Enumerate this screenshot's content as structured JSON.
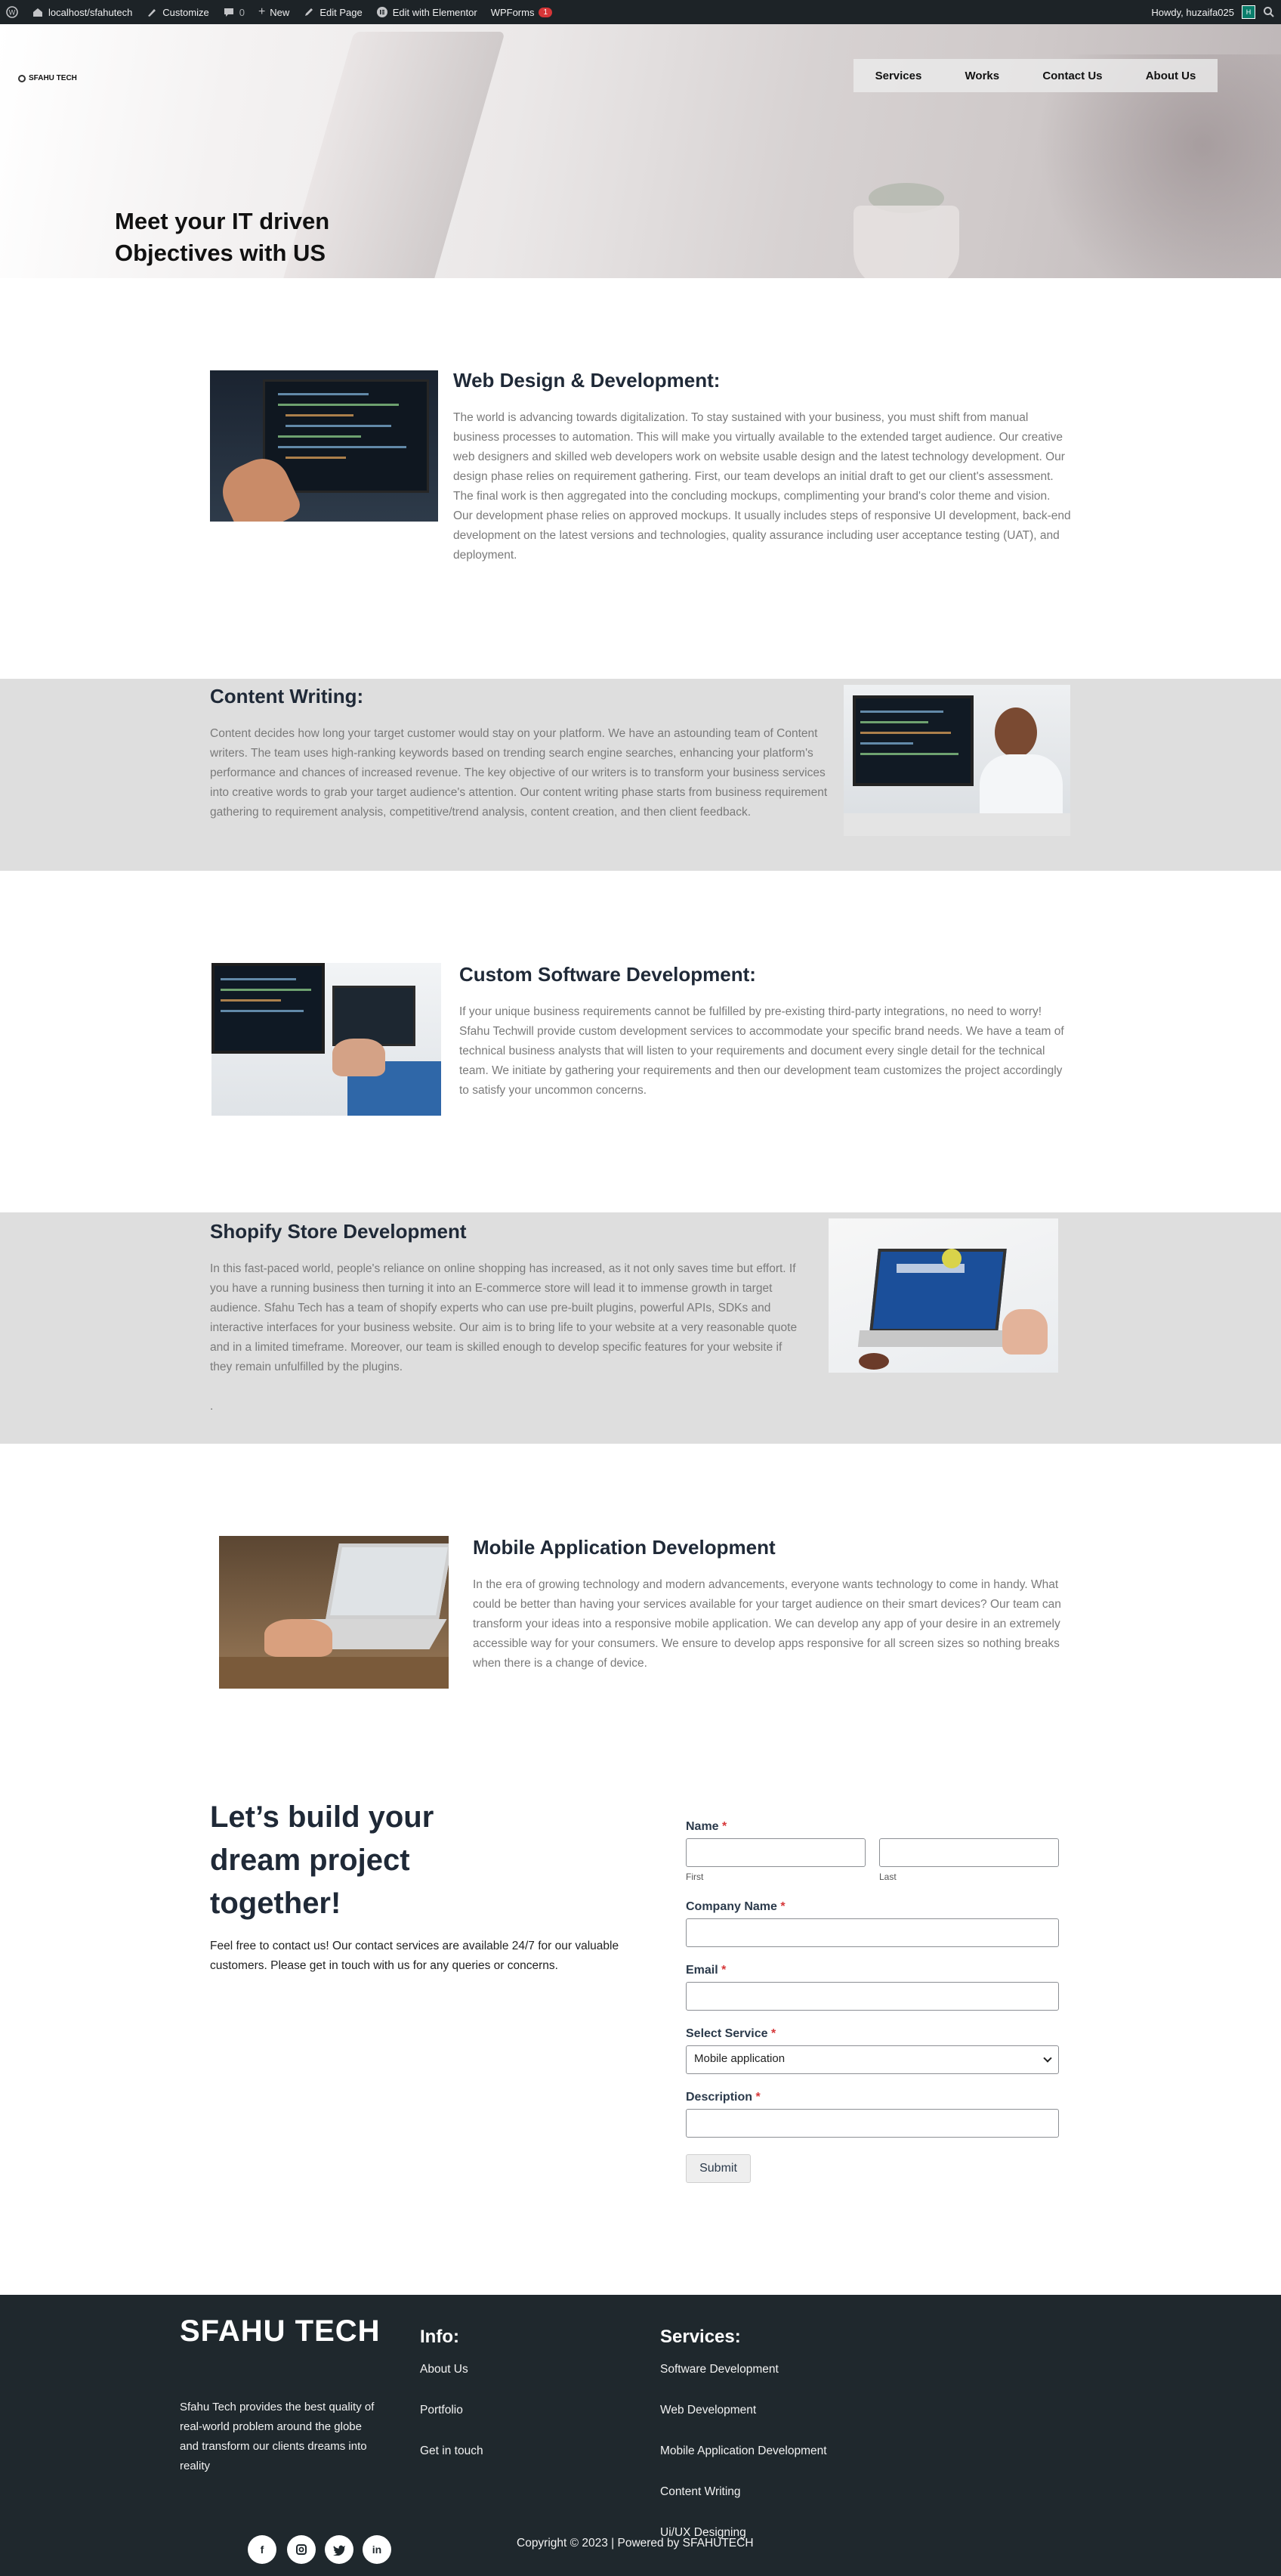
{
  "adminbar": {
    "site": "localhost/sfahutech",
    "customize": "Customize",
    "comments": "0",
    "new": "New",
    "edit_page": "Edit Page",
    "elementor": "Edit with Elementor",
    "wpforms": "WPForms",
    "wpforms_badge": "1",
    "howdy": "Howdy, huzaifa025",
    "avatar_letter": "H"
  },
  "header": {
    "logo": "SFAHU TECH",
    "nav": [
      "Services",
      "Works",
      "Contact Us",
      "About Us"
    ],
    "hero_title": "Meet your IT driven Objectives with US"
  },
  "services": [
    {
      "title": "Web Design & Development:",
      "text": "The world is advancing towards digitalization. To stay sustained with your business, you must shift from manual business processes to automation. This will make you virtually available to the extended target audience. Our creative web designers and skilled web developers work on website usable design and the latest technology development. Our design phase relies on requirement gathering. First, our team develops an initial draft to get our client's assessment. The final work is then aggregated into the concluding mockups, complimenting your brand's color theme and vision. Our development phase relies on approved mockups. It usually includes steps of responsive UI development, back-end development on the latest versions and technologies, quality assurance including user acceptance testing (UAT), and deployment."
    },
    {
      "title": "Content Writing:",
      "text": "Content decides how long your target customer would stay on your platform. We have an astounding team of Content writers. The team uses high-ranking keywords based on trending search engine searches, enhancing your platform's performance and chances of increased revenue. The key objective of our writers is to transform your business services into creative words to grab your target audience's attention. Our content writing phase starts from business requirement gathering to requirement analysis, competitive/trend analysis, content creation, and then client feedback."
    },
    {
      "title": "Custom Software Development:",
      "text": "If your unique business requirements cannot be fulfilled by pre-existing third-party integrations, no need to worry! Sfahu Techwill provide custom development services to accommodate your specific brand needs. We have a team of technical business analysts that will listen to your requirements and document every single detail for the technical team. We initiate by gathering your requirements and then our development team customizes the project accordingly to satisfy your uncommon concerns."
    },
    {
      "title": "Shopify Store Development",
      "text": "In this fast-paced world, people's reliance on online shopping has increased, as it not only saves time but effort. If you have a running business then turning it into an E-commerce store will lead it to immense growth in target audience. Sfahu Tech has a team of shopify experts who can use pre-built plugins, powerful APIs, SDKs and interactive interfaces for your business website. Our aim is to bring life to your website at a very reasonable quote and in a limited timeframe. Moreover, our team is skilled enough to develop specific features for your website if they remain unfulfilled by the plugins.",
      "dot": "."
    },
    {
      "title": "Mobile Application Development",
      "text": "In the era of growing technology and modern advancements, everyone wants technology to come in handy. What could be better than having your services available for your target audience on their smart devices? Our team can transform your ideas into a responsive mobile application. We can develop any app of your desire in an extremely accessible way for your consumers. We ensure to develop apps responsive for all screen sizes so nothing breaks when there is a change of device."
    }
  ],
  "contact": {
    "title": "Let’s build your dream project together!",
    "text": "Feel free to contact us! Our contact services are available 24/7 for our valuable customers. Please get in touch with us for any queries or concerns.",
    "form": {
      "name_label": "Name",
      "first_sub": "First",
      "last_sub": "Last",
      "company_label": "Company Name",
      "email_label": "Email",
      "service_label": "Select Service",
      "service_value": "Mobile application",
      "description_label": "Description",
      "required_mark": "*",
      "submit": "Submit"
    }
  },
  "footer": {
    "brand": "SFAHU TECH",
    "description": "Sfahu Tech provides the best quality of real-world problem around the globe and transform our clients dreams into reality",
    "info_heading": "Info:",
    "info_links": [
      "About Us",
      "Portfolio",
      "Get in touch"
    ],
    "services_heading": "Services:",
    "service_links": [
      "Software Development",
      "Web Development",
      "Mobile Application Development",
      "Content Writing",
      "Ui/UX Designing"
    ],
    "copyright": "Copyright © 2023  | Powered by SFAHUTECH"
  }
}
